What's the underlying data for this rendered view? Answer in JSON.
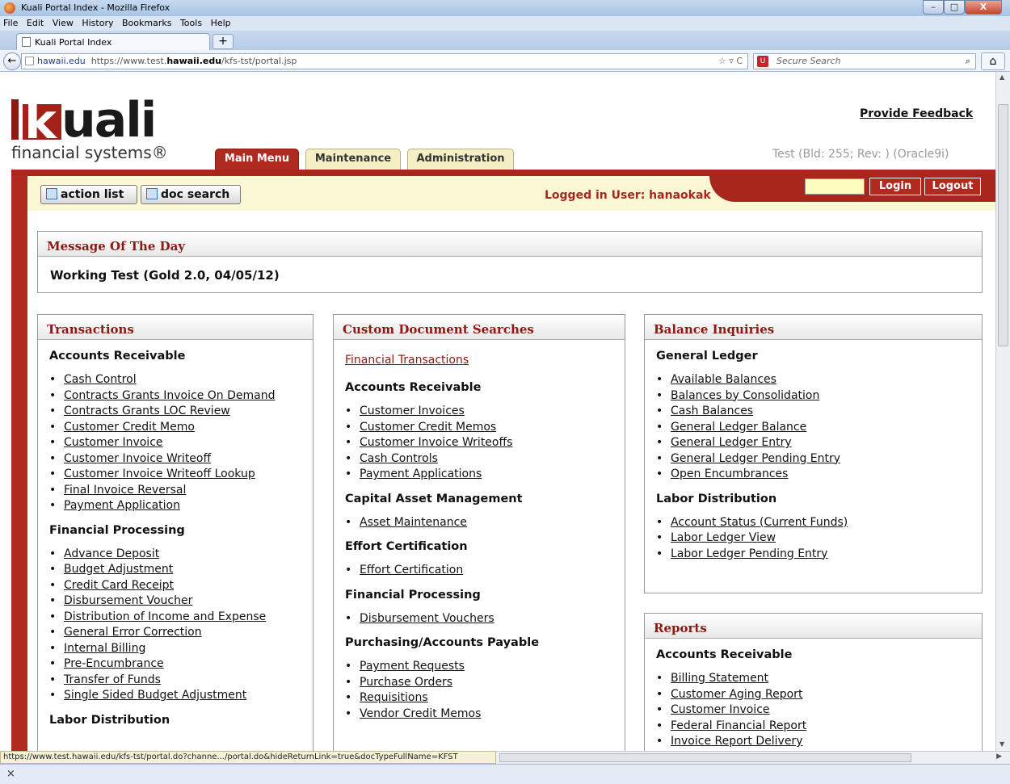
{
  "window": {
    "title": "Kuali Portal Index - Mozilla Firefox",
    "min": "–",
    "max": "□",
    "close": "X"
  },
  "menu": [
    "File",
    "Edit",
    "View",
    "History",
    "Bookmarks",
    "Tools",
    "Help"
  ],
  "browser_tab": {
    "label": "Kuali Portal Index",
    "new_tab": "+"
  },
  "urlbar": {
    "domain": "hawaii.edu",
    "url_pre": "https://www.test.",
    "url_host": "hawaii.edu",
    "url_post": "/kfs-tst/portal.jsp",
    "tools": "☆ ▿ C"
  },
  "searchbar": {
    "placeholder": "Secure Search",
    "engine": "U",
    "mag": "⌕"
  },
  "home": "⌂",
  "back": "←",
  "logo": {
    "k": "k",
    "rest": "uali",
    "sub": "financial systems®"
  },
  "header": {
    "feedback": "Provide Feedback",
    "build": "Test (Bld: 255; Rev: ) (Oracle9i)",
    "tabs": {
      "main": "Main Menu",
      "maintenance": "Maintenance",
      "administration": "Administration"
    }
  },
  "toolbar": {
    "action_list": "action list",
    "doc_search": "doc search",
    "logged_in": "Logged in User: hanaokak",
    "login": "Login",
    "logout": "Logout"
  },
  "motd": {
    "title": "Message Of The Day",
    "text": "Working Test (Gold 2.0, 04/05/12)"
  },
  "transactions": {
    "title": "Transactions",
    "sections": [
      {
        "heading": "Accounts Receivable",
        "items": [
          "Cash Control",
          "Contracts Grants Invoice On Demand",
          "Contracts Grants LOC Review",
          "Customer Credit Memo",
          "Customer Invoice",
          "Customer Invoice Writeoff",
          "Customer Invoice Writeoff Lookup",
          "Final Invoice Reversal",
          "Payment Application"
        ]
      },
      {
        "heading": "Financial Processing",
        "items": [
          "Advance Deposit",
          "Budget Adjustment",
          "Credit Card Receipt",
          "Disbursement Voucher",
          "Distribution of Income and Expense",
          "General Error Correction",
          "Internal Billing",
          "Pre-Encumbrance",
          "Transfer of Funds",
          "Single Sided Budget Adjustment"
        ]
      },
      {
        "heading": "Labor Distribution",
        "items": []
      }
    ]
  },
  "custom": {
    "title": "Custom Document Searches",
    "top_link": "Financial Transactions",
    "sections": [
      {
        "heading": "Accounts Receivable",
        "items": [
          "Customer Invoices",
          "Customer Credit Memos",
          "Customer Invoice Writeoffs",
          "Cash Controls",
          "Payment Applications"
        ]
      },
      {
        "heading": "Capital Asset Management",
        "items": [
          "Asset Maintenance"
        ]
      },
      {
        "heading": "Effort Certification",
        "items": [
          "Effort Certification"
        ]
      },
      {
        "heading": "Financial Processing",
        "items": [
          "Disbursement Vouchers"
        ]
      },
      {
        "heading": "Purchasing/Accounts Payable",
        "items": [
          "Payment Requests",
          "Purchase Orders",
          "Requisitions",
          "Vendor Credit Memos"
        ]
      }
    ]
  },
  "balance": {
    "title": "Balance Inquiries",
    "sections": [
      {
        "heading": "General Ledger",
        "items": [
          "Available Balances",
          "Balances by Consolidation",
          "Cash Balances",
          "General Ledger Balance",
          "General Ledger Entry",
          "General Ledger Pending Entry",
          "Open Encumbrances"
        ]
      },
      {
        "heading": "Labor Distribution",
        "items": [
          "Account Status (Current Funds)",
          "Labor Ledger View",
          "Labor Ledger Pending Entry"
        ]
      }
    ]
  },
  "reports": {
    "title": "Reports",
    "sections": [
      {
        "heading": "Accounts Receivable",
        "items": [
          "Billing Statement",
          "Customer Aging Report",
          "Customer Invoice",
          "Federal Financial Report",
          "Invoice Report Delivery"
        ]
      }
    ]
  },
  "status": {
    "url": "https://www.test.hawaii.edu/kfs-tst/portal.do?channe.../portal.do&hideReturnLink=true&docTypeFullName=KFST",
    "close": "×"
  }
}
